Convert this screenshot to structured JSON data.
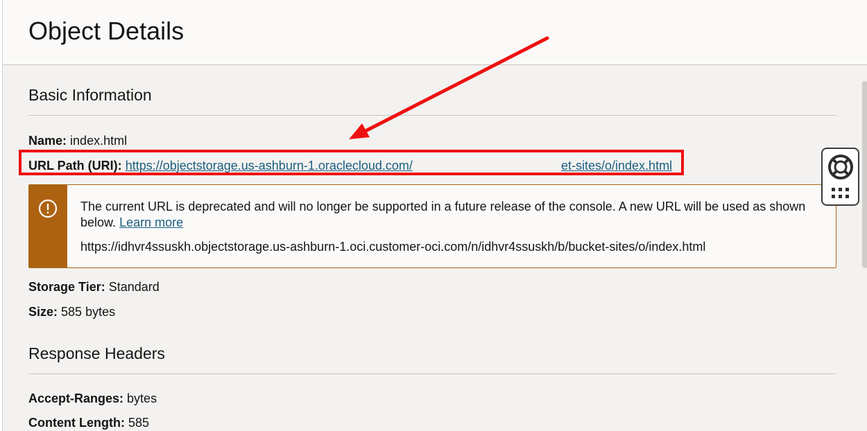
{
  "header": {
    "title": "Object Details"
  },
  "basic_info": {
    "heading": "Basic Information",
    "name_label": "Name:",
    "name_value": "index.html",
    "url_label": "URL Path (URI):",
    "url_value_part1": "https://objectstorage.us-ashburn-1.oraclecloud.com/",
    "url_value_part2": "et-sites/o/index.html",
    "storage_tier_label": "Storage Tier:",
    "storage_tier_value": "Standard",
    "size_label": "Size:",
    "size_value": "585 bytes"
  },
  "notice": {
    "message": "The current URL is deprecated and will no longer be supported in a future release of the console. A new URL will be used as shown below.",
    "learn_more": "Learn more",
    "new_url": "https://idhvr4ssuskh.objectstorage.us-ashburn-1.oci.customer-oci.com/n/idhvr4ssuskh/b/bucket-sites/o/index.html",
    "icon": "warning-circle-icon"
  },
  "response_headers": {
    "heading": "Response Headers",
    "accept_ranges_label": "Accept-Ranges:",
    "accept_ranges_value": "bytes",
    "content_length_label": "Content Length:",
    "content_length_value": "585"
  },
  "help_widget": {
    "icons": [
      "lifebuoy-icon",
      "grid-dots-icon"
    ]
  },
  "colors": {
    "annotation": "#ee1111",
    "notice_accent": "#ad6212",
    "link": "#1b5e80"
  }
}
